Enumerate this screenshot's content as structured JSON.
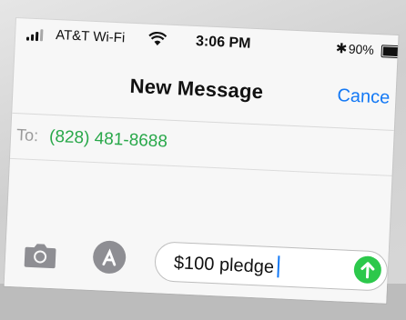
{
  "status_bar": {
    "carrier": "AT&T Wi-Fi",
    "time": "3:06 PM",
    "battery_percent": "90%",
    "battery_level": 0.9,
    "icons": [
      "signal-icon",
      "wifi-icon",
      "bluetooth-icon",
      "battery-icon"
    ]
  },
  "nav": {
    "title": "New Message",
    "cancel_label": "Cance"
  },
  "recipient": {
    "label": "To:",
    "number": "(828) 481-8688"
  },
  "composer": {
    "text": "$100 pledge",
    "icons": [
      "camera-icon",
      "app-store-icon",
      "send-arrow-icon"
    ]
  },
  "colors": {
    "accent_blue": "#1479f5",
    "recipient_green": "#29a84a",
    "send_green": "#2cc84b"
  }
}
